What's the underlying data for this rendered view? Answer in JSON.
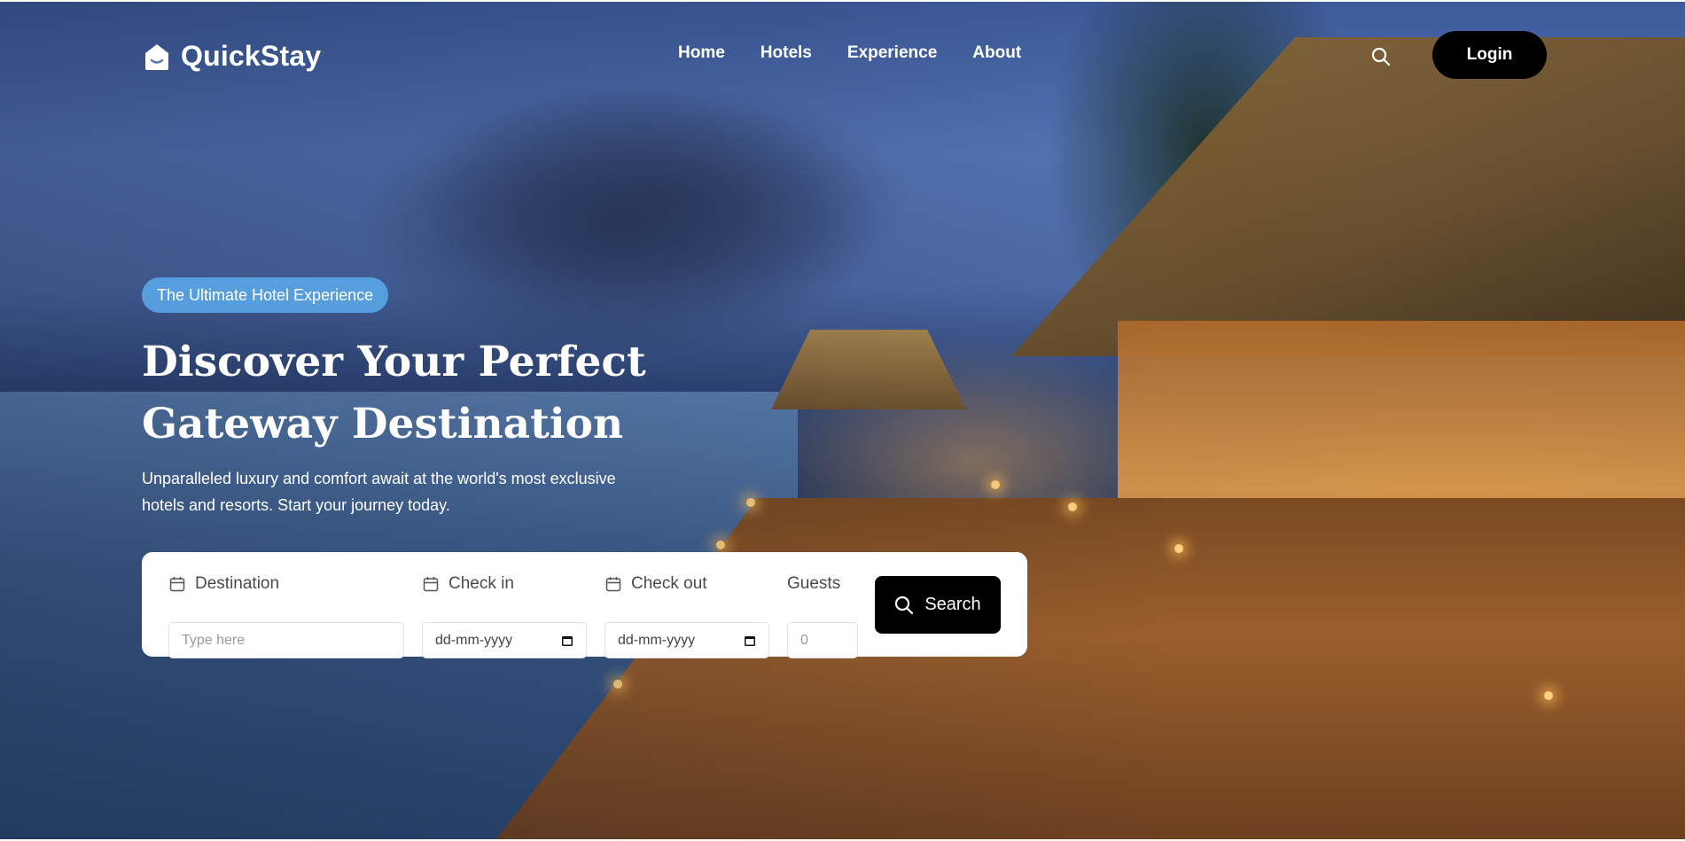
{
  "brand": {
    "name": "QuickStay",
    "logo_icon": "house-smile-icon"
  },
  "nav": {
    "items": [
      "Home",
      "Hotels",
      "Experience",
      "About"
    ],
    "search_icon": "search-icon",
    "login_label": "Login"
  },
  "hero": {
    "badge": "The Ultimate Hotel Experience",
    "headline_line1": "Discover Your Perfect",
    "headline_line2": "Gateway Destination",
    "subtitle_line1": "Unparalleled luxury and comfort await at the world's most exclusive",
    "subtitle_line2": "hotels and resorts. Start your journey today."
  },
  "search": {
    "destination": {
      "label": "Destination",
      "placeholder": "Type here",
      "icon": "calendar-icon"
    },
    "check_in": {
      "label": "Check in",
      "placeholder": "dd-mm-yyyy",
      "icon": "calendar-icon"
    },
    "check_out": {
      "label": "Check out",
      "placeholder": "dd-mm-yyyy",
      "icon": "calendar-icon"
    },
    "guests": {
      "label": "Guests",
      "placeholder": "0"
    },
    "submit_label": "Search",
    "submit_icon": "search-icon"
  },
  "colors": {
    "button_bg": "#000000",
    "badge_bg": "#5aaaeb",
    "panel_bg": "#ffffff"
  }
}
